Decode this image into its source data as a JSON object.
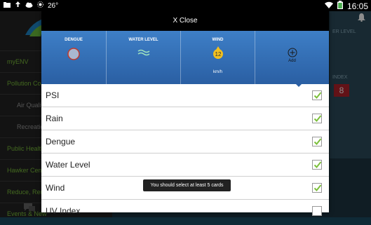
{
  "status_bar": {
    "temperature": "26°",
    "time": "16:05"
  },
  "drawer": {
    "items": [
      {
        "label": "myENV"
      },
      {
        "label": "Pollution Co"
      },
      {
        "label": "Air Quality"
      },
      {
        "label": "Recreatio"
      },
      {
        "label": "Public Health"
      },
      {
        "label": "Hawker Centr"
      },
      {
        "label": "Reduce, Reus"
      },
      {
        "label": "Events & New"
      }
    ]
  },
  "background_panel": {
    "label_top": "ER LEVEL",
    "label_mid": "INDEX",
    "red_value": "8"
  },
  "dialog": {
    "close_label": "X Close",
    "cards": [
      {
        "title": "DENGUE",
        "subtitle": ""
      },
      {
        "title": "WATER LEVEL",
        "subtitle": ""
      },
      {
        "title": "WIND",
        "value": "12",
        "subtitle": "km/h"
      },
      {
        "title": "",
        "subtitle": "Add"
      }
    ],
    "options": [
      {
        "label": "PSI",
        "checked": true
      },
      {
        "label": "Rain",
        "checked": true
      },
      {
        "label": "Dengue",
        "checked": true
      },
      {
        "label": "Water Level",
        "checked": true
      },
      {
        "label": "Wind",
        "checked": true
      },
      {
        "label": "UV Index",
        "checked": false
      }
    ]
  },
  "toast": {
    "message": "You should select at least 5 cards"
  },
  "colors": {
    "accent_blue": "#2a5fa3",
    "check_green": "#7bbf3a",
    "drawer_text_green": "#7bbf3a"
  }
}
